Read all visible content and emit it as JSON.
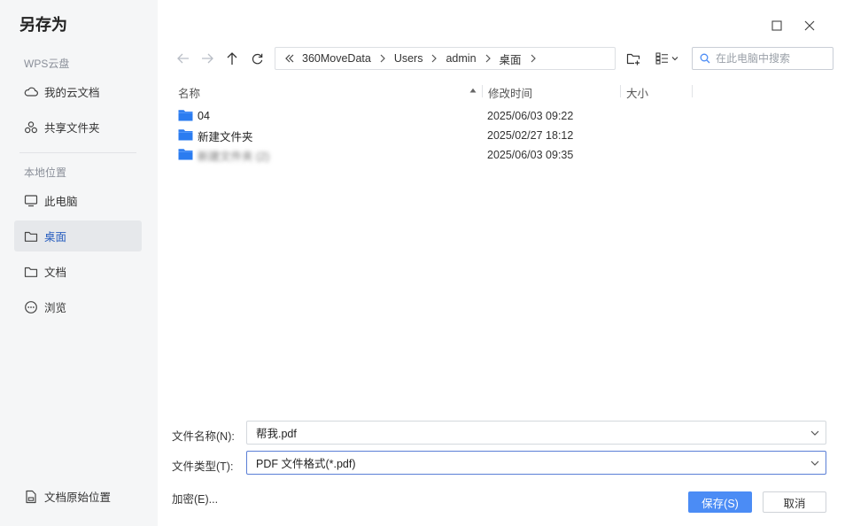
{
  "dialog": {
    "title": "另存为"
  },
  "sidebar": {
    "cloud_section": "WPS云盘",
    "cloud_items": [
      {
        "label": "我的云文档",
        "icon": "cloud-icon"
      },
      {
        "label": "共享文件夹",
        "icon": "share-folder-icon"
      }
    ],
    "local_section": "本地位置",
    "local_items": [
      {
        "label": "此电脑",
        "icon": "computer-icon"
      },
      {
        "label": "桌面",
        "icon": "folder-icon",
        "active": true
      },
      {
        "label": "文档",
        "icon": "folder-icon"
      },
      {
        "label": "浏览",
        "icon": "more-icon"
      }
    ],
    "bottom_item": {
      "label": "文档原始位置",
      "icon": "document-icon"
    }
  },
  "breadcrumb": [
    "360MoveData",
    "Users",
    "admin",
    "桌面"
  ],
  "search": {
    "placeholder": "在此电脑中搜索"
  },
  "columns": {
    "name": "名称",
    "modified": "修改时间",
    "size": "大小"
  },
  "files": [
    {
      "name": "04",
      "modified": "2025/06/03 09:22",
      "blurred": false
    },
    {
      "name": "新建文件夹",
      "modified": "2025/02/27 18:12",
      "blurred": false
    },
    {
      "name": "新建文件夹 (2)",
      "modified": "2025/06/03 09:35",
      "blurred": true
    }
  ],
  "form": {
    "filename_label": "文件名称(N):",
    "filename_value": "帮我.pdf",
    "filetype_label": "文件类型(T):",
    "filetype_value": "PDF 文件格式(*.pdf)"
  },
  "actions": {
    "encrypt": "加密(E)...",
    "save": "保存(S)",
    "cancel": "取消"
  },
  "colors": {
    "accent": "#4b8cf5",
    "folder": "#2b7cf0",
    "sidebar_bg": "#f5f6f7"
  }
}
